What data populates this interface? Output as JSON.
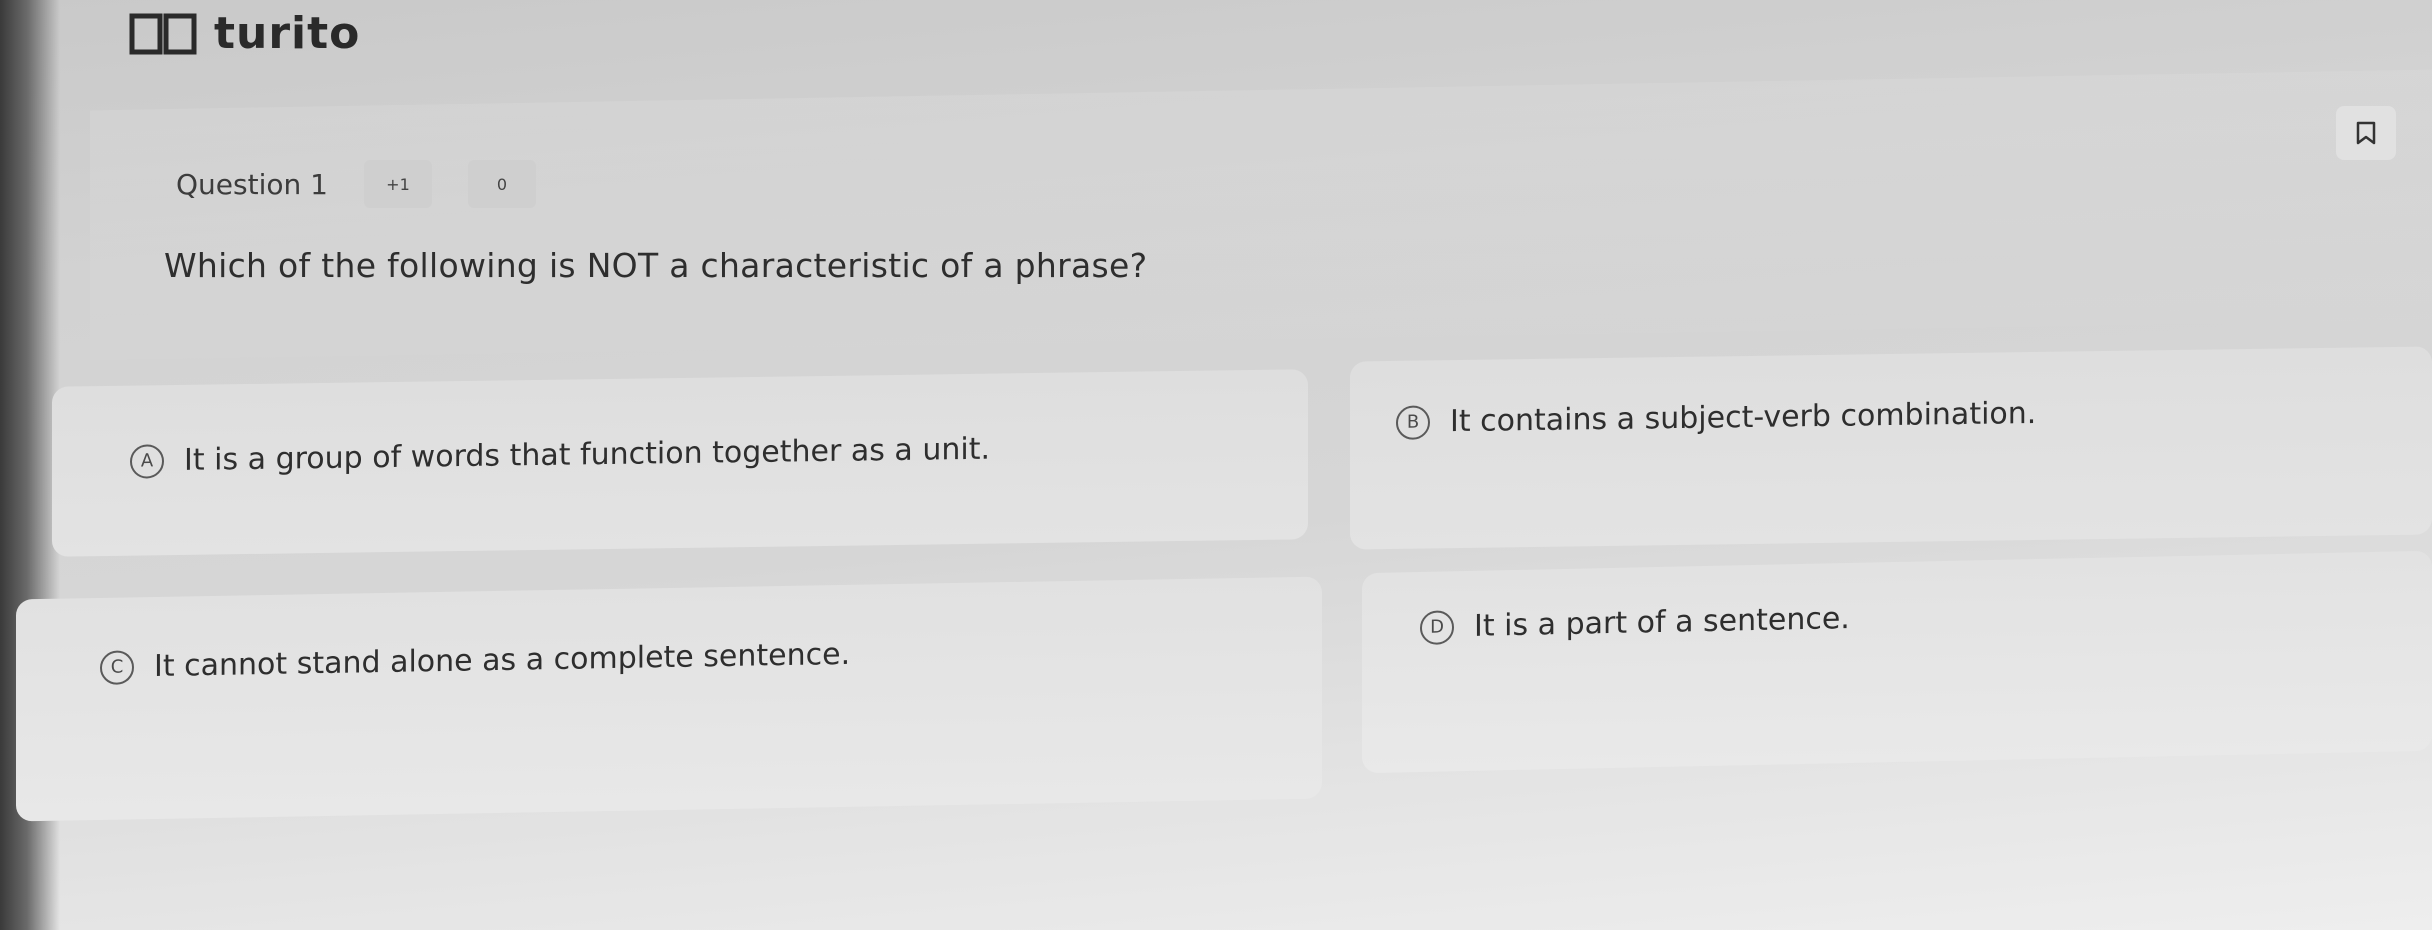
{
  "app": {
    "name": "turito"
  },
  "question": {
    "label": "Question 1",
    "marks": "+1",
    "negative": "0",
    "text": "Which of the following is NOT a characteristic of a phrase?"
  },
  "options": [
    {
      "letter": "A",
      "text": "It is a group of words that function together as a unit."
    },
    {
      "letter": "B",
      "text": "It contains a subject-verb combination."
    },
    {
      "letter": "C",
      "text": "It cannot stand alone as a complete sentence."
    },
    {
      "letter": "D",
      "text": "It is a part of a sentence."
    }
  ],
  "icons": {
    "logo": "book-icon",
    "bookmark": "bookmark-icon"
  }
}
